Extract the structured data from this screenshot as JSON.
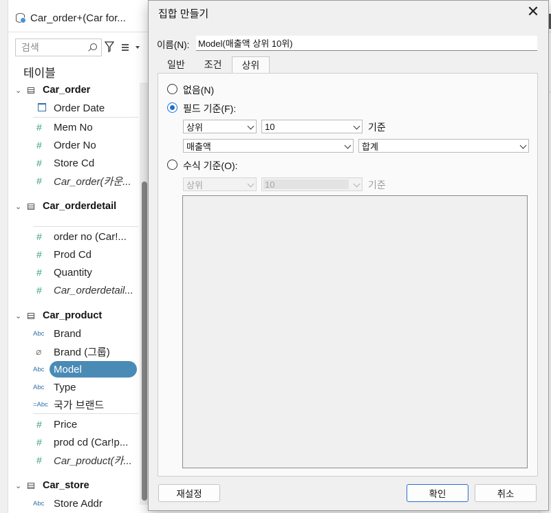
{
  "left_pane": {
    "datasource": "Car_order+(Car for...",
    "search_placeholder": "검색",
    "tables_label": "테이블",
    "tables": [
      {
        "name": "Car_order",
        "fields": [
          "Order Date",
          "Mem No",
          "Order No",
          "Store Cd",
          "Car_order(카운..."
        ]
      },
      {
        "name": "Car_orderdetail",
        "fields": [
          "order no (Car!...",
          "Prod Cd",
          "Quantity",
          "Car_orderdetail..."
        ]
      },
      {
        "name": "Car_product",
        "fields": [
          "Brand",
          "Brand (그룹)",
          "Model",
          "Type",
          "국가 브랜드",
          "Price",
          "prod cd (Car!p...",
          "Car_product(카..."
        ]
      },
      {
        "name": "Car_store",
        "fields": [
          "Store Addr"
        ]
      }
    ],
    "icons": {
      "abc": "Abc",
      "geo_abc": "=Abc",
      "hash": "#",
      "clip": "⌀"
    },
    "selected_field_color": "#4a8bb6"
  },
  "dialog": {
    "title": "집합 만들기",
    "close_glyph": "✕",
    "name_label": "이름(N):",
    "name_value": "Model(매출액 상위 10위)",
    "tabs": [
      "일반",
      "조건",
      "상위"
    ],
    "active_tab": "상위",
    "options": {
      "none_label": "없음(N)",
      "by_field_label": "필드 기준(F):",
      "by_formula_label": "수식 기준(O):",
      "selected": "by_field"
    },
    "by_field": {
      "direction": "상위",
      "count": "10",
      "suffix": "기준",
      "field": "매출액",
      "aggregation": "합계"
    },
    "by_formula": {
      "direction": "상위",
      "count": "10",
      "suffix": "기준"
    },
    "buttons": {
      "reset": "재설정",
      "ok": "확인",
      "cancel": "취소"
    },
    "accent_color": "#1a6fd1"
  }
}
